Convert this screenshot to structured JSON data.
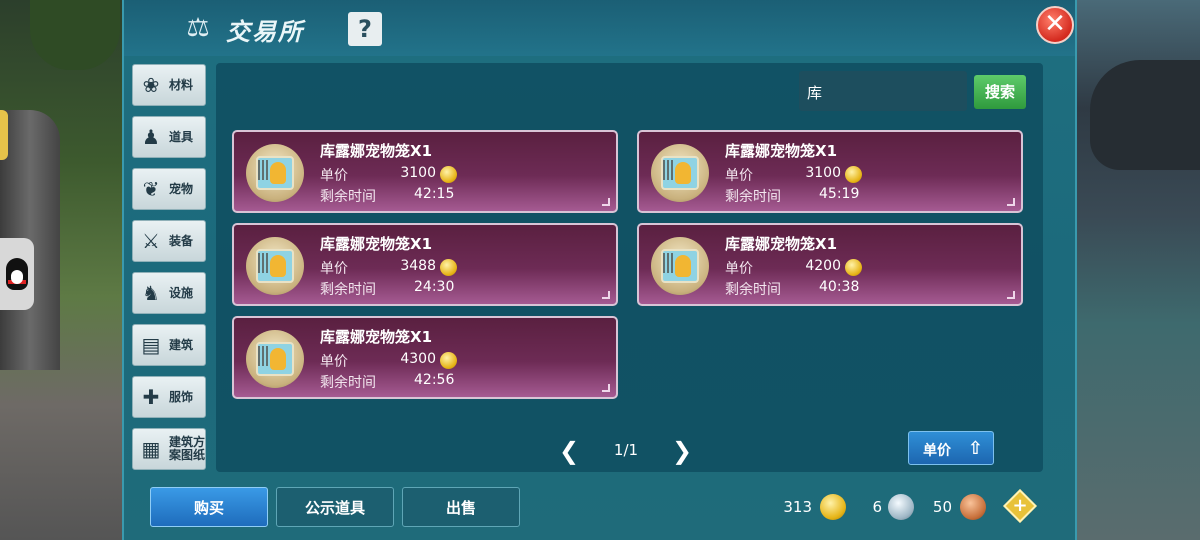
{
  "window": {
    "title": "交易所",
    "help_label": "?",
    "close_label": "✕"
  },
  "categories": [
    {
      "label": "材料",
      "icon": "materials-icon",
      "glyph": "❀"
    },
    {
      "label": "道具",
      "icon": "tool-icon",
      "glyph": "♟"
    },
    {
      "label": "宠物",
      "icon": "paw-icon",
      "glyph": "❦"
    },
    {
      "label": "装备",
      "icon": "sword-icon",
      "glyph": "⚔"
    },
    {
      "label": "设施",
      "icon": "facility-icon",
      "glyph": "♞"
    },
    {
      "label": "建筑",
      "icon": "brick-icon",
      "glyph": "▤"
    },
    {
      "label": "服饰",
      "icon": "clothing-icon",
      "glyph": "✚"
    },
    {
      "label": "建筑方\n案图纸",
      "icon": "blueprint-icon",
      "glyph": "▦"
    }
  ],
  "search": {
    "query": "库",
    "button_label": "搜索"
  },
  "listings": [
    {
      "name": "库露娜宠物笼X1",
      "price_label": "单价",
      "price": "3100",
      "time_label": "剩余时间",
      "time": "42:15"
    },
    {
      "name": "库露娜宠物笼X1",
      "price_label": "单价",
      "price": "3100",
      "time_label": "剩余时间",
      "time": "45:19"
    },
    {
      "name": "库露娜宠物笼X1",
      "price_label": "单价",
      "price": "3488",
      "time_label": "剩余时间",
      "time": "24:30"
    },
    {
      "name": "库露娜宠物笼X1",
      "price_label": "单价",
      "price": "4200",
      "time_label": "剩余时间",
      "time": "40:38"
    },
    {
      "name": "库露娜宠物笼X1",
      "price_label": "单价",
      "price": "4300",
      "time_label": "剩余时间",
      "time": "42:56"
    }
  ],
  "pager": {
    "text": "1/1",
    "prev": "❮",
    "next": "❯"
  },
  "sort": {
    "label": "单价",
    "arrow": "⇧"
  },
  "bottom": {
    "buy_label": "购买",
    "public_label": "公示道具",
    "sell_label": "出售"
  },
  "currency": {
    "gold": "313",
    "silver": "6",
    "copper": "50",
    "add_label": "+"
  }
}
